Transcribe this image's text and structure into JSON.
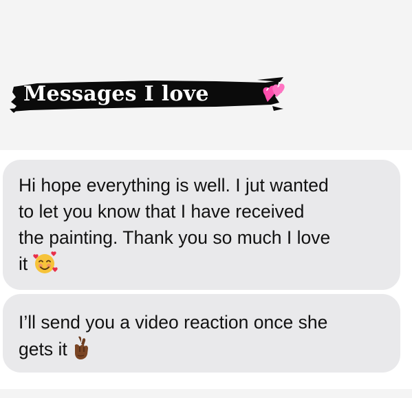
{
  "banner": {
    "title": "Messages I love",
    "heart_icon": "sparkling-heart-icon",
    "stroke_color": "#0b0b0b"
  },
  "messages": [
    {
      "text": "Hi hope everything is well. I jut wanted\nto let you know that I have received\nthe painting. Thank you so much I love\nit",
      "emoji": "smiling-face-with-hearts-icon"
    },
    {
      "text": "I’ll send you a video reaction once she\ngets it",
      "emoji": "crossed-fingers-icon"
    }
  ],
  "colors": {
    "bubble": "#e9e9eb",
    "background_top": "#f4f4f4",
    "text": "#111111"
  }
}
